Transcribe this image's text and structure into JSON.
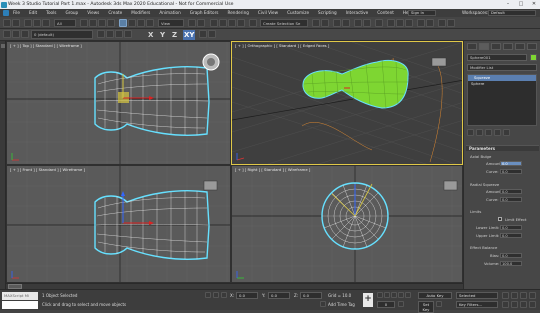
{
  "window": {
    "title": "Week 3 Studio Tutorial Part 1.max - Autodesk 3ds Max 2020 Educational - Not for Commercial Use",
    "minimize": "–",
    "maximize": "□",
    "close": "✕"
  },
  "menu": {
    "items": [
      "File",
      "Edit",
      "Tools",
      "Group",
      "Views",
      "Create",
      "Modifiers",
      "Animation",
      "Graph Editors",
      "Rendering",
      "Civil View",
      "Customize",
      "Scripting",
      "Interactive",
      "Content",
      "Help"
    ],
    "signin": "Sign In",
    "workspaces_label": "Workspaces:",
    "workspace": "Default"
  },
  "toolbar": {
    "filter": "All",
    "refcoord": "View",
    "selset": "Create Selection Se"
  },
  "ribbon": {
    "axes": [
      "X",
      "Y",
      "Z",
      "XY"
    ],
    "layer": "0 (default)"
  },
  "viewports": {
    "top": {
      "label": "[ + ] [ Top ] [ Standard ] [ Wireframe ]"
    },
    "persp": {
      "label": "[ + ] [ Orthographic ] [ Standard ] [ Edged Faces ]"
    },
    "front": {
      "label": "[ + ] [ Front ] [ Standard ] [ Wireframe ]"
    },
    "right": {
      "label": "[ + ] [ Right ] [ Standard ] [ Wireframe ]"
    }
  },
  "command_panel": {
    "object_name": "Sphere001",
    "modifier_list": "Modifier List",
    "stack": [
      "Squeeze",
      "Sphere"
    ],
    "parameters": "Parameters",
    "axial_bulge": "Axial Bulge",
    "amount": "Amount:",
    "curve": "Curve:",
    "axial_bulge_amount": "0.0",
    "axial_bulge_curve": "0.0",
    "radial_squeeze": "Radial Squeeze",
    "radial_squeeze_amount": "0.0",
    "radial_squeeze_curve": "0.0",
    "limits": "Limits",
    "limit_effect": "Limit Effect",
    "lower_limit": "Lower Limit:",
    "lower_limit_value": "0.0",
    "upper_limit": "Upper Limit:",
    "upper_limit_value": "0.0",
    "effect_balance": "Effect Balance",
    "bias": "Bias:",
    "bias_value": "0.0",
    "volume": "Volume:",
    "volume_value": "100.0"
  },
  "statusbar": {
    "maxscript": "MAXScript Mi",
    "selected": "1 Object Selected",
    "prompt": "Click and drag to select and move objects",
    "x_label": "X:",
    "x_value": "0.0",
    "y_label": "Y:",
    "y_value": "0.0",
    "z_label": "Z:",
    "z_value": "0.0",
    "grid": "Grid = 10.0",
    "add_time_tag": "Add Time Tag",
    "frame": "0",
    "autokey": "Auto Key",
    "setkey": "Set Key",
    "selected_dropdown": "Selected",
    "key_filters": "Key Filters..."
  },
  "colors": {
    "accent": "#4a72b0",
    "wire": "#e8e8e8",
    "selection": "#66e0ff",
    "object": "#7ed632",
    "active_border": "#e0c848"
  }
}
